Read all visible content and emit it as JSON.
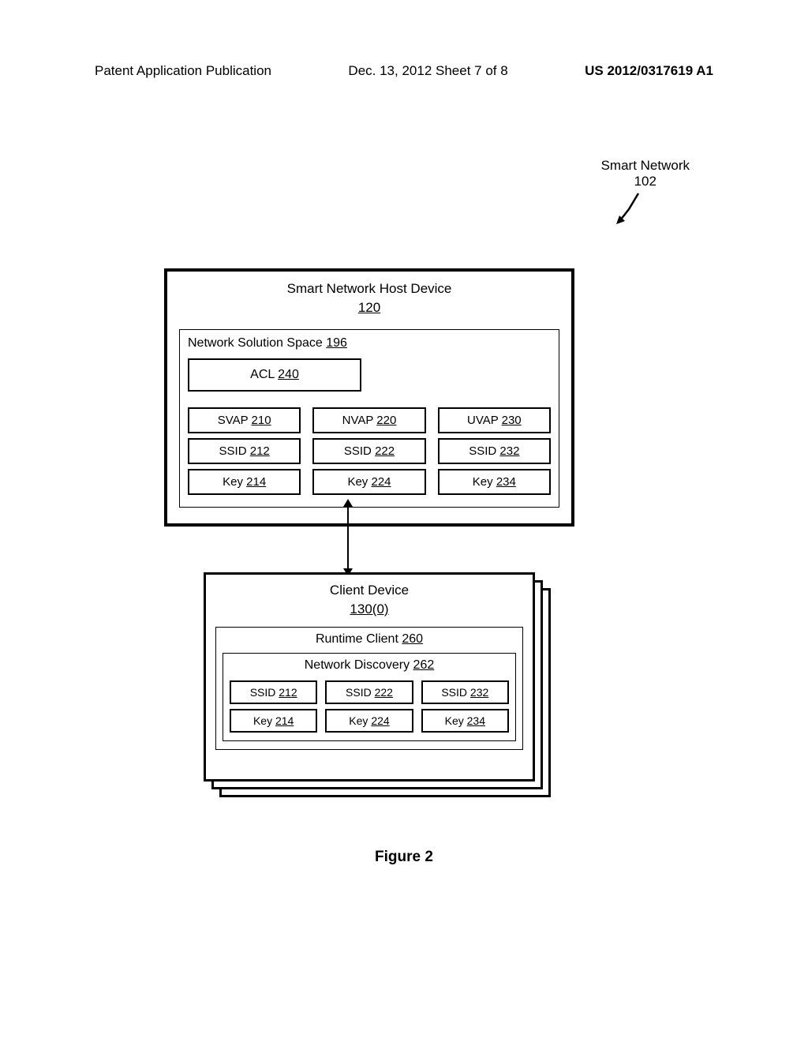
{
  "header": {
    "left": "Patent Application Publication",
    "center": "Dec. 13, 2012  Sheet 7 of 8",
    "right": "US 2012/0317619 A1"
  },
  "smart_network": {
    "label": "Smart Network",
    "num": "102"
  },
  "host": {
    "title": "Smart Network Host Device",
    "num": "120",
    "nss": {
      "label": "Network Solution Space",
      "num": "196"
    },
    "acl": {
      "label": "ACL",
      "num": "240"
    },
    "cols": [
      {
        "vap": {
          "label": "SVAP",
          "num": "210"
        },
        "ssid": {
          "label": "SSID",
          "num": "212"
        },
        "key": {
          "label": "Key",
          "num": "214"
        }
      },
      {
        "vap": {
          "label": "NVAP",
          "num": "220"
        },
        "ssid": {
          "label": "SSID",
          "num": "222"
        },
        "key": {
          "label": "Key",
          "num": "224"
        }
      },
      {
        "vap": {
          "label": "UVAP",
          "num": "230"
        },
        "ssid": {
          "label": "SSID",
          "num": "232"
        },
        "key": {
          "label": "Key",
          "num": "234"
        }
      }
    ]
  },
  "client": {
    "title": "Client Device",
    "num": "130(0)",
    "runtime": {
      "label": "Runtime Client",
      "num": "260"
    },
    "discovery": {
      "label": "Network Discovery",
      "num": "262"
    },
    "cols": [
      {
        "ssid": {
          "label": "SSID",
          "num": "212"
        },
        "key": {
          "label": "Key",
          "num": "214"
        }
      },
      {
        "ssid": {
          "label": "SSID",
          "num": "222"
        },
        "key": {
          "label": "Key",
          "num": "224"
        }
      },
      {
        "ssid": {
          "label": "SSID",
          "num": "232"
        },
        "key": {
          "label": "Key",
          "num": "234"
        }
      }
    ]
  },
  "figure": "Figure 2"
}
